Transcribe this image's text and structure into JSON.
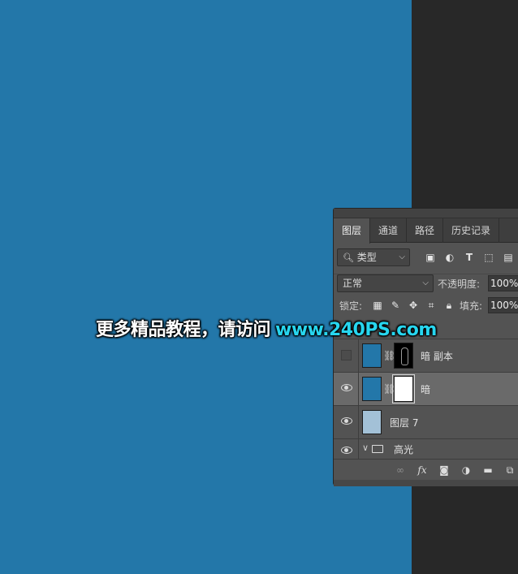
{
  "watermark": {
    "text_cn": "更多精品教程，请访问",
    "url": "www.240PS.com"
  },
  "layers_panel": {
    "tabs": [
      {
        "label": "图层",
        "active": true
      },
      {
        "label": "通道",
        "active": false
      },
      {
        "label": "路径",
        "active": false
      },
      {
        "label": "历史记录",
        "active": false
      }
    ],
    "filter": {
      "kind_label": "类型",
      "icons": [
        "image-icon",
        "adjustment-icon",
        "text-icon",
        "shape-icon",
        "smart-object-icon"
      ]
    },
    "blend_mode": "正常",
    "opacity_label": "不透明度:",
    "opacity_value": "100%",
    "lock_label": "锁定:",
    "lock_icons": [
      "lock-transparent-icon",
      "lock-paint-icon",
      "lock-move-icon",
      "lock-artboard-icon",
      "lock-all-icon"
    ],
    "fill_label": "填充:",
    "fill_value": "100%",
    "layers": [
      {
        "name": "暗 副本",
        "visible": false,
        "has_mask": true,
        "mask": "dark",
        "selected": false
      },
      {
        "name": "暗",
        "visible": true,
        "has_mask": true,
        "mask": "white",
        "selected": true
      },
      {
        "name": "图层 7",
        "visible": true,
        "has_mask": false,
        "selected": false
      },
      {
        "name": "高光",
        "visible": true,
        "type": "group",
        "selected": false
      }
    ],
    "bottom_icons": [
      "link-icon",
      "fx-icon",
      "add-mask-icon",
      "adjustment-layer-icon",
      "new-group-icon",
      "new-layer-icon"
    ],
    "fx_label": "fx"
  },
  "colors": {
    "canvas": "#2377a9",
    "workspace": "#282828",
    "panel": "#535353",
    "watermark_url": "#27d6ef"
  }
}
